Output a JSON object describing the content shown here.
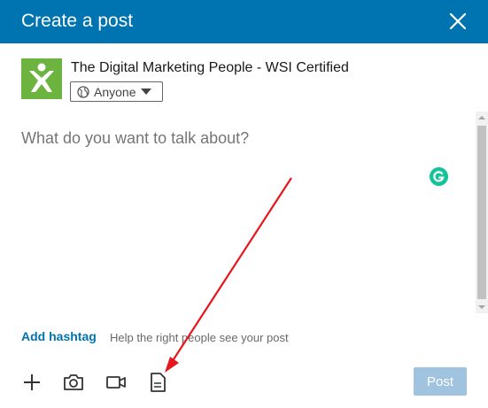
{
  "dialog": {
    "title": "Create a post",
    "close_icon": "close-icon"
  },
  "author": {
    "name": "The Digital Marketing People - WSI Certified",
    "logo_icon": "company-logo",
    "logo_color": "#6cb33f",
    "visibility": "Anyone"
  },
  "editor": {
    "placeholder": "What do you want to talk about?",
    "grammarly_icon": "grammarly-icon"
  },
  "hashtag": {
    "link_label": "Add hashtag",
    "hint": "Help the right people see your post"
  },
  "toolbar": {
    "items": [
      {
        "icon": "plus-icon"
      },
      {
        "icon": "camera-icon"
      },
      {
        "icon": "video-icon"
      },
      {
        "icon": "document-icon"
      }
    ],
    "post_label": "Post"
  },
  "colors": {
    "header": "#0073b1",
    "link": "#0073b1",
    "post_button_disabled": "#a0c4e0",
    "annotation_arrow": "#e8151b"
  }
}
